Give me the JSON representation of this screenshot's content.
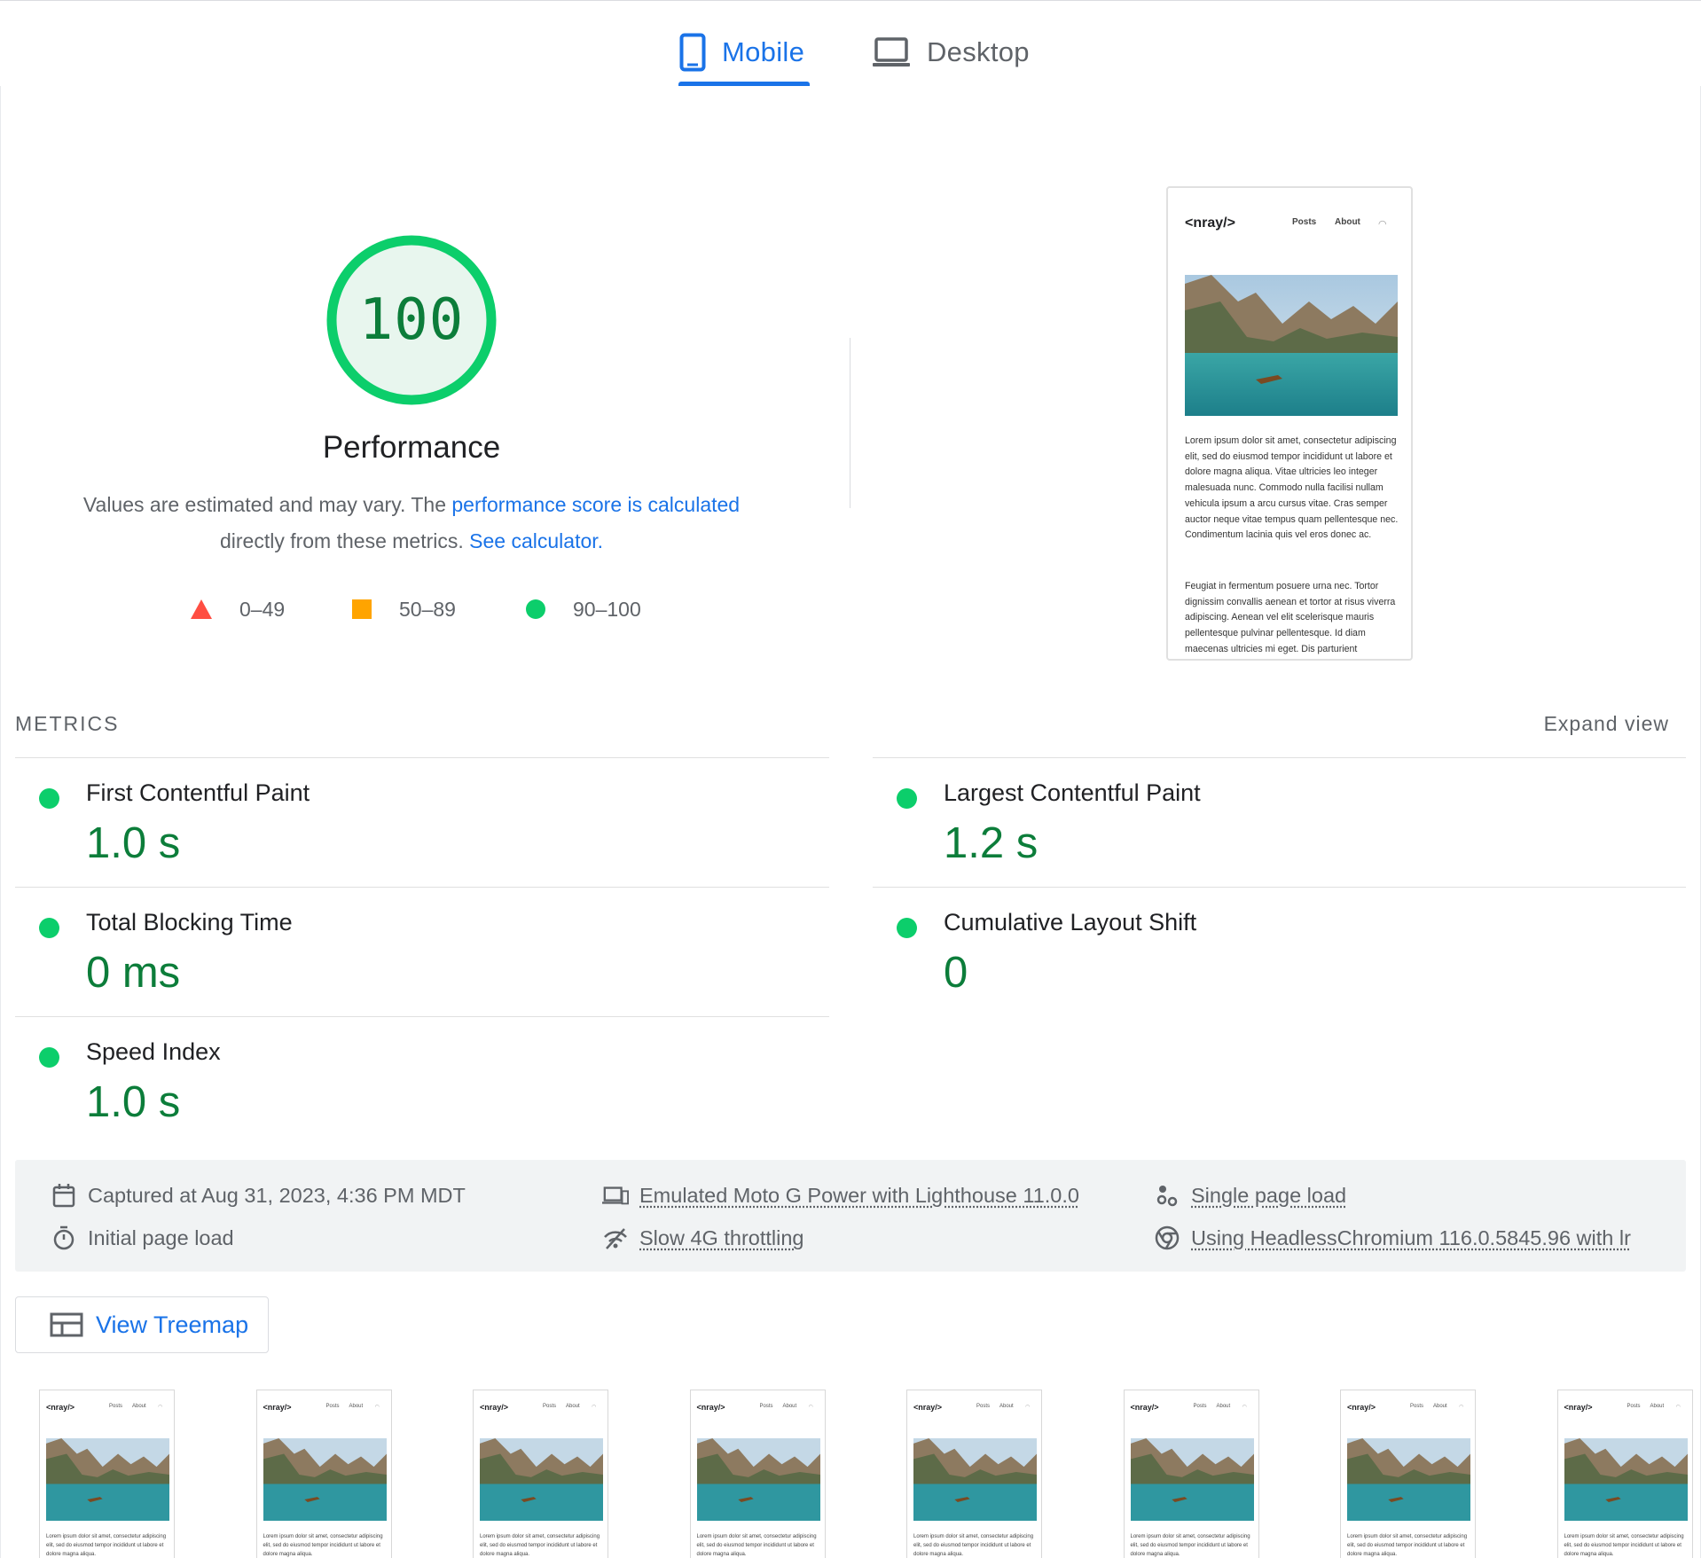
{
  "tabs": {
    "mobile": "Mobile",
    "desktop": "Desktop",
    "active": "mobile"
  },
  "gauge": {
    "score": "100",
    "score_fraction": 1.0,
    "title": "Performance",
    "desc_prefix": "Values are estimated and may vary. The ",
    "desc_link": "performance score is calculated",
    "desc_middle": " directly from these metrics. ",
    "desc_link2": "See calculator."
  },
  "legend": [
    {
      "range": "0–49",
      "shape": "triangle",
      "color": "#ff4e42"
    },
    {
      "range": "50–89",
      "shape": "square",
      "color": "#ffa400"
    },
    {
      "range": "90–100",
      "shape": "circle",
      "color": "#0cce6b"
    }
  ],
  "preview": {
    "logo": "<nray/>",
    "nav": [
      "Posts",
      "About"
    ],
    "rss_icon": "rss-icon",
    "para1": "Lorem ipsum dolor sit amet, consectetur adipiscing elit, sed do eiusmod tempor incididunt ut labore et dolore magna aliqua. Vitae ultricies leo integer malesuada nunc. Commodo nulla facilisi nullam vehicula ipsum a arcu cursus vitae. Cras semper auctor neque vitae tempus quam pellentesque nec. Condimentum lacinia quis vel eros donec ac.",
    "para2": "Feugiat in fermentum posuere urna nec. Tortor dignissim convallis aenean et tortor at risus viverra adipiscing. Aenean vel elit scelerisque mauris pellentesque pulvinar pellentesque. Id diam maecenas ultricies mi eget. Dis parturient"
  },
  "metrics": {
    "title": "METRICS",
    "expand": "Expand view",
    "items": [
      {
        "name": "First Contentful Paint",
        "value": "1.0 s"
      },
      {
        "name": "Largest Contentful Paint",
        "value": "1.2 s"
      },
      {
        "name": "Total Blocking Time",
        "value": "0 ms"
      },
      {
        "name": "Cumulative Layout Shift",
        "value": "0"
      },
      {
        "name": "Speed Index",
        "value": "1.0 s"
      }
    ]
  },
  "info": {
    "captured": "Captured at Aug 31, 2023, 4:36 PM MDT",
    "initial": "Initial page load",
    "device": "Emulated Moto G Power with Lighthouse 11.0.0",
    "throttling": "Slow 4G throttling",
    "single": "Single page load",
    "browser": "Using HeadlessChromium 116.0.5845.96 with lr"
  },
  "treemap": {
    "label": "View Treemap"
  },
  "filmstrip": {
    "frames": 8,
    "logo": "<nray/>",
    "nav": [
      "Posts",
      "About"
    ],
    "text": "Lorem ipsum dolor sit amet, consectetur adipiscing elit, sed do eiusmod tempor incididunt ut labore et dolore magna aliqua."
  },
  "colors": {
    "accent": "#1a73e8",
    "pass": "#0cce6b",
    "pass_text": "#0c7d3a",
    "fail": "#ff4e42",
    "average": "#ffa400"
  }
}
